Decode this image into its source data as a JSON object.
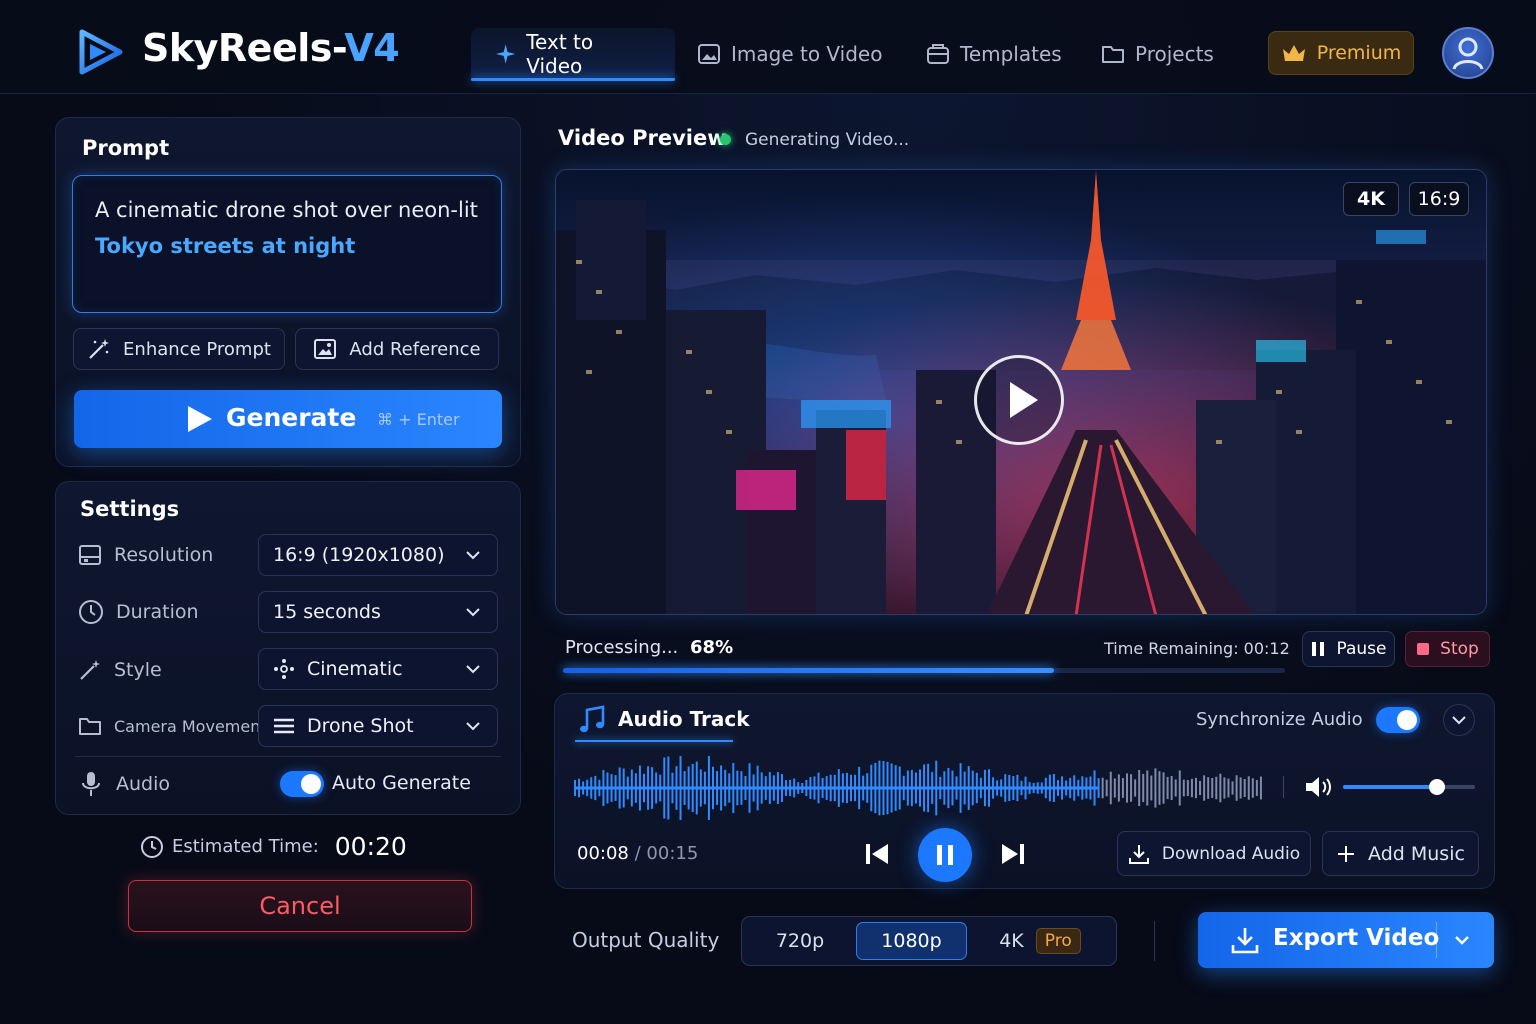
{
  "app": {
    "name_main": "SkyReels-",
    "name_version": "V4"
  },
  "nav": {
    "tabs": [
      {
        "label": "Text to Video",
        "active": true,
        "icon": "sparkle-icon"
      },
      {
        "label": "Image to Video",
        "active": false,
        "icon": "image-icon"
      },
      {
        "label": "Templates",
        "active": false,
        "icon": "template-icon"
      },
      {
        "label": "Projects",
        "active": false,
        "icon": "folder-icon"
      }
    ],
    "premium_label": "Premium"
  },
  "prompt": {
    "title": "Prompt",
    "text_line1": "A cinematic drone shot over neon-lit",
    "text_line2": "Tokyo streets at night",
    "enhance_label": "Enhance Prompt",
    "reference_label": "Add Reference",
    "generate_label": "Generate",
    "generate_shortcut": "⌘ + Enter"
  },
  "settings": {
    "title": "Settings",
    "resolution": {
      "label": "Resolution",
      "value": "16:9 (1920x1080)"
    },
    "duration": {
      "label": "Duration",
      "value": "15 seconds"
    },
    "style": {
      "label": "Style",
      "value": "Cinematic"
    },
    "camera": {
      "label": "Camera Movement",
      "value": "Drone Shot"
    },
    "audio": {
      "label": "Audio",
      "toggle_label": "Auto Generate",
      "enabled": true
    }
  },
  "estimate": {
    "label": "Estimated Time:",
    "value": "00:20"
  },
  "cancel_label": "Cancel",
  "preview": {
    "title": "Video Preview",
    "status": "Generating Video...",
    "badge_res": "4K",
    "badge_ratio": "16:9",
    "processing_label": "Processing...",
    "processing_percent": "68%",
    "progress": 0.68,
    "time_remaining": "Time Remaining: 00:12",
    "pause_label": "Pause",
    "stop_label": "Stop"
  },
  "audio_track": {
    "title": "Audio Track",
    "sync_label": "Synchronize Audio",
    "sync_enabled": true,
    "current_time": "00:08",
    "separator": "/",
    "total_time": "00:15",
    "volume": 0.71,
    "download_label": "Download Audio",
    "add_music_label": "Add Music"
  },
  "output": {
    "label": "Output Quality",
    "options": [
      "720p",
      "1080p",
      "4K"
    ],
    "selected": "1080p",
    "pro_tag": "Pro",
    "export_label": "Export Video"
  },
  "colors": {
    "accent": "#2f8bff",
    "premium": "#f0b64a",
    "danger": "#ff5a63",
    "background": "#070b18"
  }
}
